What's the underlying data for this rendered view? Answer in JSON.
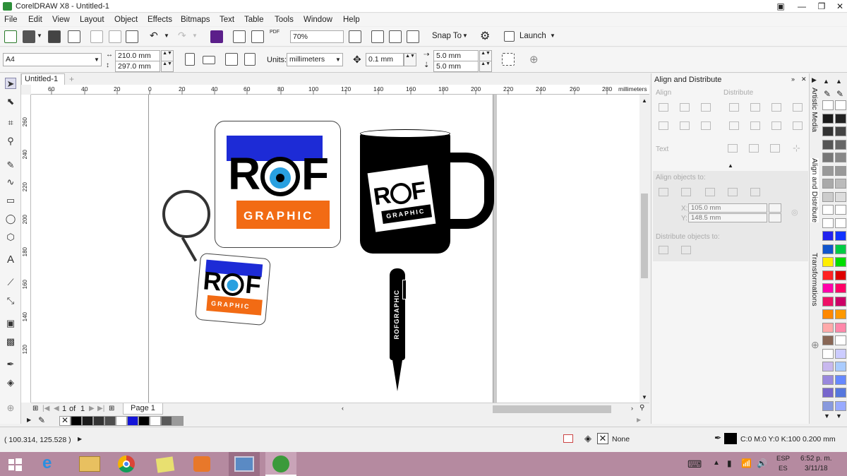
{
  "window": {
    "title": "CorelDRAW X8 - Untitled-1",
    "minimize": "—",
    "restore": "❐",
    "close": "✕"
  },
  "menu": [
    "File",
    "Edit",
    "View",
    "Layout",
    "Object",
    "Effects",
    "Bitmaps",
    "Text",
    "Table",
    "Tools",
    "Window",
    "Help"
  ],
  "toolbar": {
    "zoom": "70%",
    "snap_to": "Snap To",
    "launch": "Launch",
    "pdf": "PDF"
  },
  "propbar": {
    "page_size": "A4",
    "width": "210.0 mm",
    "height": "297.0 mm",
    "units_label": "Units:",
    "units": "millimeters",
    "nudge": "0.1 mm",
    "dup_x": "5.0 mm",
    "dup_y": "5.0 mm"
  },
  "document": {
    "tab": "Untitled-1"
  },
  "ruler": {
    "h_labels": [
      "60",
      "40",
      "20",
      "0",
      "20",
      "40",
      "60",
      "80",
      "100",
      "120",
      "140",
      "160",
      "180",
      "200",
      "220",
      "240",
      "260",
      "280"
    ],
    "unit": "millimeters",
    "v_labels": [
      "260",
      "240",
      "220",
      "200",
      "180",
      "160",
      "140",
      "120"
    ]
  },
  "artwork": {
    "logo_top": "R",
    "logo_bottom": "F",
    "logo_sub": "GRAPHIC",
    "pen_text": "ROFGRAPHIC"
  },
  "pagenav": {
    "current": "1",
    "of": "of",
    "total": "1",
    "page_tab": "Page 1"
  },
  "docker": {
    "title": "Align and Distribute",
    "align": "Align",
    "distribute": "Distribute",
    "text": "Text",
    "align_objects_to": "Align objects to:",
    "x_label": "X:",
    "x_value": "105.0 mm",
    "y_label": "Y:",
    "y_value": "148.5 mm",
    "distribute_objects_to": "Distribute objects to:"
  },
  "docker_tabs": [
    "Artistic Media",
    "Align and Distribute",
    "Transformations"
  ],
  "status": {
    "coords": "( 100.314, 125.528 )",
    "fill": "None",
    "outline": "C:0 M:0 Y:0 K:100  0.200 mm"
  },
  "taskbar": {
    "lang": "ESP",
    "lang2": "ES",
    "time": "6:52 p. m.",
    "date": "3/11/18"
  },
  "colors": {
    "accent": "#d75c1e",
    "blue": "#1d2bd6",
    "eye": "#29a0e0",
    "mug": "#000000",
    "taskbar": "#b58aa0"
  },
  "palette_bottom": [
    "#000000",
    "#1a1a1a",
    "#333333",
    "#4d4d4d",
    "#ffffff",
    "#1414d8",
    "#000000",
    "#ffffff",
    "#5a5a5a",
    "#9a9a9a"
  ],
  "palette_right_a": [
    "#ffffff",
    "#1a1a1a",
    "#333333",
    "#555555",
    "#777777",
    "#999999",
    "#aaaaaa",
    "#cccccc",
    "#ffffff",
    "#ffffff",
    "#2222ee",
    "#1155cc",
    "#ffee00",
    "#ff2222",
    "#ff00aa",
    "#ee1166",
    "#ff8800",
    "#ffaaaa",
    "#886655",
    "#ffffff",
    "#c8b8ee",
    "#9988dd",
    "#7766cc",
    "#8899dd"
  ],
  "palette_right_b": [
    "#ffffff",
    "#222222",
    "#444444",
    "#666666",
    "#888888",
    "#999999",
    "#bbbbbb",
    "#dddddd",
    "#ffffff",
    "#ffffff",
    "#1133ff",
    "#00cc44",
    "#00dd00",
    "#dd0000",
    "#ff0066",
    "#cc0066",
    "#ff9900",
    "#ff88aa",
    "#ffffff",
    "#ccccff",
    "#aaccff",
    "#6688ff",
    "#5577dd",
    "#99aaff"
  ]
}
